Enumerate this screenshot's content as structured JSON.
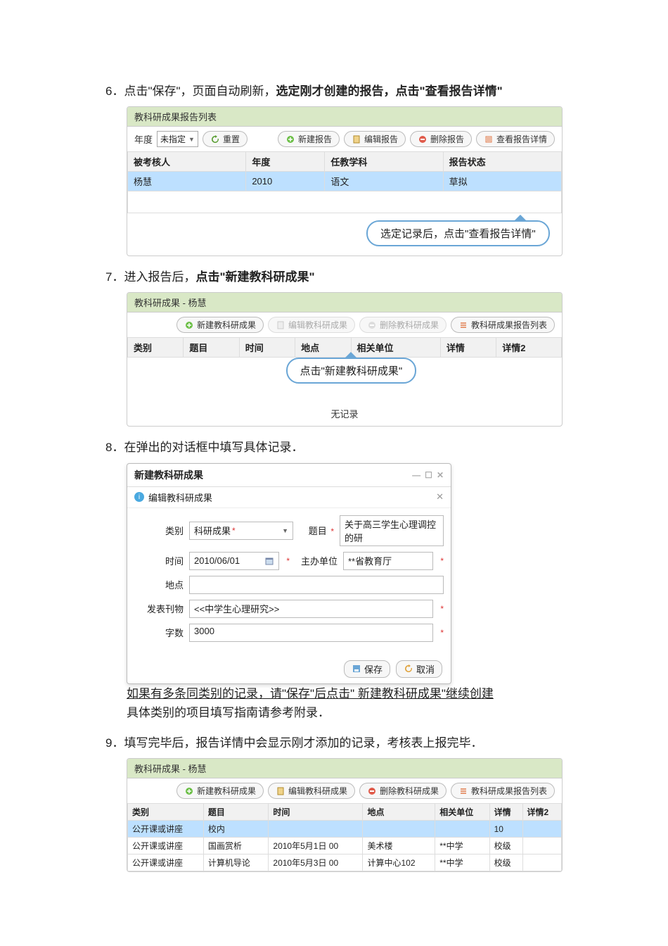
{
  "step6": {
    "num": "6．",
    "pre": "点击\"保存\"，页面自动刷新，",
    "bold": "选定刚才创建的报告，点击\"查看报告详情\""
  },
  "panel1": {
    "title": "教科研成果报告列表",
    "year_label": "年度",
    "year_value": "未指定",
    "reset": "重置",
    "btn_new": "新建报告",
    "btn_edit": "编辑报告",
    "btn_del": "删除报告",
    "btn_view": "查看报告详情",
    "cols": {
      "c1": "被考核人",
      "c2": "年度",
      "c3": "任教学科",
      "c4": "报告状态"
    },
    "row": {
      "c1": "杨慧",
      "c2": "2010",
      "c3": "语文",
      "c4": "草拟"
    },
    "callout": "选定记录后，点击\"查看报告详情\""
  },
  "step7": {
    "num": "7．",
    "pre": "进入报告后，",
    "bold": "点击\"新建教科研成果\""
  },
  "panel2": {
    "title": "教科研成果 - 杨慧",
    "btn_new": "新建教科研成果",
    "btn_edit": "编辑教科研成果",
    "btn_del": "删除教科研成果",
    "btn_list": "教科研成果报告列表",
    "cols": {
      "c1": "类别",
      "c2": "题目",
      "c3": "时间",
      "c4": "地点",
      "c5": "相关单位",
      "c6": "详情",
      "c7": "详情2"
    },
    "callout": "点击\"新建教科研成果\"",
    "norecord": "无记录"
  },
  "step8": {
    "num": "8．",
    "text": "在弹出的对话框中填写具体记录．"
  },
  "dialog": {
    "title": "新建教科研成果",
    "sub": "编辑教科研成果",
    "f_type_lab": "类别",
    "f_type_val": "科研成果",
    "f_topic_lab": "题目",
    "f_topic_val": "关于高三学生心理调控的研",
    "f_time_lab": "时间",
    "f_time_val": "2010/06/01",
    "f_host_lab": "主办单位",
    "f_host_val": "**省教育厅",
    "f_place_lab": "地点",
    "f_pub_lab": "发表刊物",
    "f_pub_val": "<<中学生心理研究>>",
    "f_words_lab": "字数",
    "f_words_val": "3000",
    "save": "保存",
    "cancel": "取消"
  },
  "step8_note1": "如果有多条同类别的记录，请\"保存\"后点击\" 新建教科研成果\"继续创建",
  "step8_note2": "具体类别的项目填写指南请参考附录．",
  "step9": {
    "num": "9．",
    "text": "填写完毕后，报告详情中会显示刚才添加的记录，考核表上报完毕．"
  },
  "panel3": {
    "title": "教科研成果 - 杨慧",
    "btn_new": "新建教科研成果",
    "btn_edit": "编辑教科研成果",
    "btn_del": "删除教科研成果",
    "btn_list": "教科研成果报告列表",
    "cols": {
      "c1": "类别",
      "c2": "题目",
      "c3": "时间",
      "c4": "地点",
      "c5": "相关单位",
      "c6": "详情",
      "c7": "详情2"
    },
    "rows": [
      {
        "c1": "公开课或讲座",
        "c2": "校内",
        "c3": "",
        "c4": "",
        "c5": "",
        "c6": "10",
        "c7": ""
      },
      {
        "c1": "公开课或讲座",
        "c2": "国画赏析",
        "c3": "2010年5月1日 00",
        "c4": "美术楼",
        "c5": "**中学",
        "c6": "校级",
        "c7": ""
      },
      {
        "c1": "公开课或讲座",
        "c2": "计算机导论",
        "c3": "2010年5月3日 00",
        "c4": "计算中心102",
        "c5": "**中学",
        "c6": "校级",
        "c7": ""
      }
    ]
  }
}
